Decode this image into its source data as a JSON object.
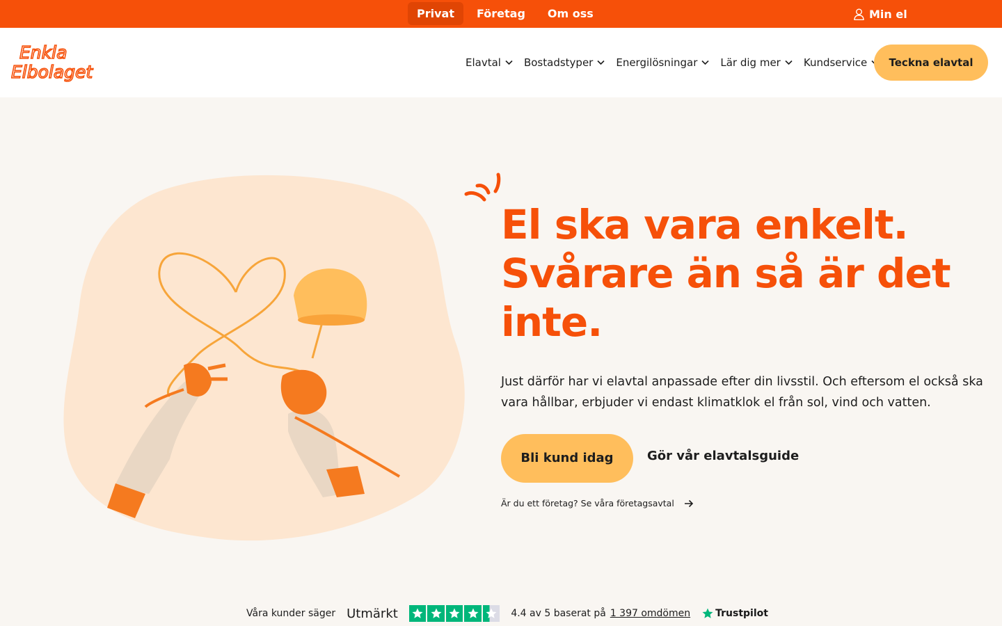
{
  "topbar": {
    "nav": [
      {
        "label": "Privat",
        "active": true
      },
      {
        "label": "Företag",
        "active": false
      },
      {
        "label": "Om oss",
        "active": false
      }
    ],
    "account_label": "Min el",
    "account_icon": "user-icon",
    "color": "#f65009"
  },
  "header": {
    "logo": {
      "line1": "Enkla",
      "line2": "Elbolaget"
    },
    "nav": [
      {
        "label": "Elavtal",
        "icon": "chevron-down-icon"
      },
      {
        "label": "Bostadstyper",
        "icon": "chevron-down-icon"
      },
      {
        "label": "Energilösningar",
        "icon": "chevron-down-icon"
      },
      {
        "label": "Lär dig mer",
        "icon": "chevron-down-icon"
      },
      {
        "label": "Kundservice",
        "icon": "chevron-down-icon"
      }
    ],
    "cta_label": "Teckna elavtal"
  },
  "hero": {
    "headline": [
      "El ska vara enkelt.",
      "Svårare än så är det",
      "inte."
    ],
    "lede": "Just därför har vi elavtal anpassade efter din livsstil. Och eftersom el också ska vara hållbar, erbjuder vi endast klimatklok el från sol, vind och vatten.",
    "primary_cta": "Bli kund idag",
    "secondary_cta": "Gör vår elavtalsguide",
    "business_link": "Är du ett företag? Se våra företagsavtal",
    "accent_color": "#f65009",
    "button_color": "#ffbe5c"
  },
  "trustpilot": {
    "label": "Våra kunder säger",
    "rating_word": "Utmärkt",
    "score_text": "4.4 av 5 baserat på",
    "reviews_link": "1 397 omdömen",
    "brand": "Trustpilot",
    "stars": 4.4,
    "star_color": "#00b67a"
  }
}
